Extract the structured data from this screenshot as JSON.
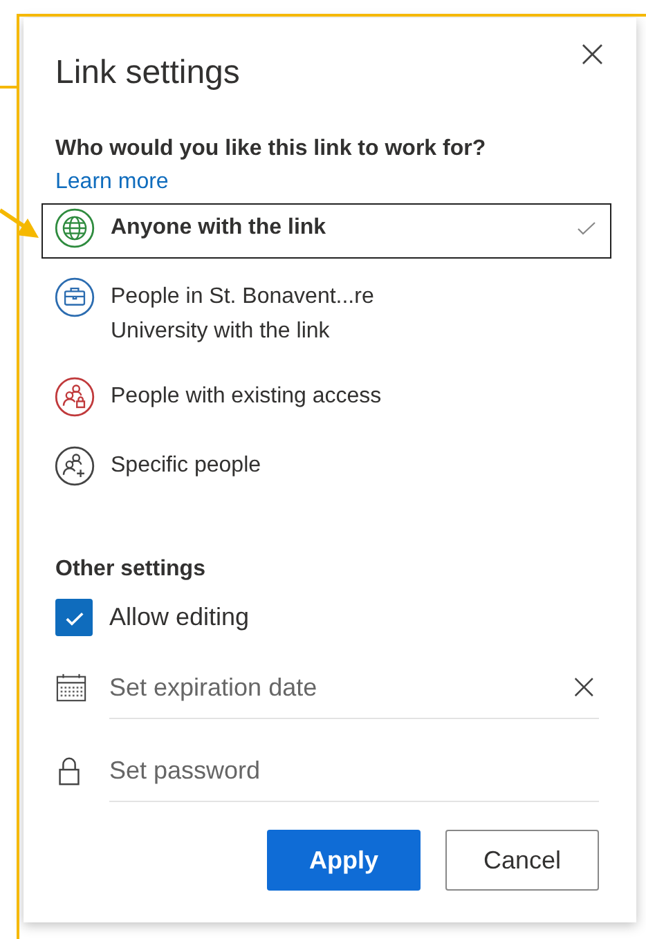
{
  "dialog": {
    "title": "Link settings",
    "close_label": "×"
  },
  "audience": {
    "question": "Who would you like this link to work for?",
    "learn_more": "Learn more",
    "options": [
      {
        "kind": "globe",
        "color": "#2e8b3e",
        "lines": [
          "Anyone with the link"
        ],
        "selected": true
      },
      {
        "kind": "organization",
        "color": "#2b6cb0",
        "lines": [
          "People in St. Bonavent...re",
          "University with the link"
        ],
        "selected": false
      },
      {
        "kind": "existing",
        "color": "#c0393b",
        "lines": [
          "People with existing access"
        ],
        "selected": false
      },
      {
        "kind": "specific",
        "color": "#444444",
        "lines": [
          "Specific people"
        ],
        "selected": false
      }
    ]
  },
  "other_settings": {
    "heading": "Other settings",
    "allow_editing": {
      "label": "Allow editing",
      "checked": true
    },
    "expiration": {
      "placeholder": "Set expiration date",
      "clear_label": "×"
    },
    "password": {
      "placeholder": "Set password"
    }
  },
  "buttons": {
    "apply": "Apply",
    "cancel": "Cancel"
  }
}
